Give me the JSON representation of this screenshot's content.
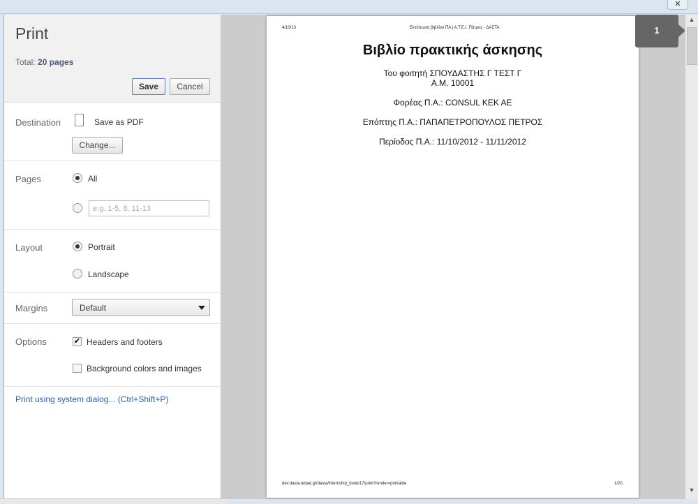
{
  "sidebar": {
    "title": "Print",
    "total_label": "Total:",
    "total_value": "20 pages",
    "save": "Save",
    "cancel": "Cancel",
    "destination": {
      "label": "Destination",
      "value": "Save as PDF",
      "change": "Change..."
    },
    "pages": {
      "label": "Pages",
      "all": "All",
      "custom_placeholder": "e.g. 1-5, 8, 11-13",
      "selected": "All"
    },
    "layout": {
      "label": "Layout",
      "portrait": "Portrait",
      "landscape": "Landscape",
      "selected": "Portrait"
    },
    "margins": {
      "label": "Margins",
      "value": "Default"
    },
    "options": {
      "label": "Options",
      "headers": "Headers and footers",
      "headers_checked": true,
      "background": "Background colors and images",
      "background_checked": false
    },
    "system_dialog": "Print using system dialog... (Ctrl+Shift+P)"
  },
  "preview": {
    "page_number": "1",
    "page": {
      "header_date": "4/10/13",
      "header_title": "Εκτύπωση βιβλίου ΠΑ | Α.Τ.Ε.Ι. Πάτρας - ΔΑΣΤΑ",
      "title": "Βιβλίο πρακτικής άσκησης",
      "student": "Του φοιτητή ΣΠΟΥΔΑΣΤΗΣ Γ ΤΕΣΤ Γ",
      "am": "Α.Μ. 10001",
      "foreas": "Φορέας Π.Α.: CONSUL KEK AE",
      "epoptis": "Επόπτης Π.Α.: ΠΑΠΑΠΕΤΡΟΠΟΥΛΟΣ ΠΕΤΡΟΣ",
      "period": "Περίοδος Π.Α.: 11/10/2012 - 11/11/2012",
      "footer_url": "dev.dasta.teipat.gr/dasta/internship_book/17/print?render=printable",
      "footer_page": "1/20"
    }
  }
}
